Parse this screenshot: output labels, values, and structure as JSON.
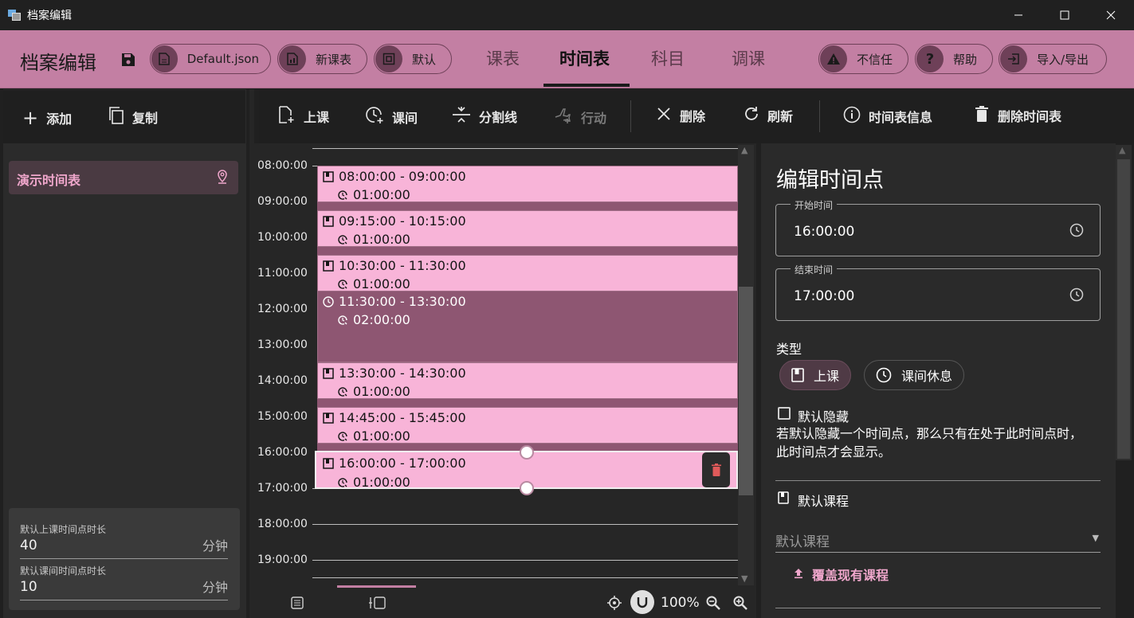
{
  "window": {
    "title": "档案编辑"
  },
  "header": {
    "app_title": "档案编辑",
    "pills": {
      "file": "Default.json",
      "new_schedule": "新课表",
      "default": "默认",
      "distrust": "不信任",
      "help": "帮助",
      "import_export": "导入/导出"
    },
    "tabs": {
      "schedule": "课表",
      "timetable": "时间表",
      "subjects": "科目",
      "swap": "调课"
    },
    "active_tab": "时间表"
  },
  "left": {
    "toolbar": {
      "add": "添加",
      "copy": "复制"
    },
    "items": [
      {
        "label": "演示时间表"
      }
    ],
    "defaults": {
      "lesson_label": "默认上课时间点时长",
      "lesson_value": "40",
      "lesson_unit": "分钟",
      "break_label": "默认课间时间点时长",
      "break_value": "10",
      "break_unit": "分钟"
    }
  },
  "toolbar": {
    "lesson": "上课",
    "break": "课间",
    "divider": "分割线",
    "action": "行动",
    "delete": "删除",
    "refresh": "刷新",
    "info": "时间表信息",
    "delete_table": "删除时间表"
  },
  "timeline": {
    "hours": [
      "08:00:00",
      "09:00:00",
      "10:00:00",
      "11:00:00",
      "12:00:00",
      "13:00:00",
      "14:00:00",
      "15:00:00",
      "16:00:00",
      "17:00:00",
      "18:00:00",
      "19:00:00"
    ],
    "slots": [
      {
        "kind": "lesson",
        "range": "08:00:00 - 09:00:00",
        "duration": "01:00:00"
      },
      {
        "kind": "lesson",
        "range": "09:15:00 - 10:15:00",
        "duration": "01:00:00"
      },
      {
        "kind": "lesson",
        "range": "10:30:00 - 11:30:00",
        "duration": "01:00:00"
      },
      {
        "kind": "break",
        "range": "11:30:00 - 13:30:00",
        "duration": "02:00:00"
      },
      {
        "kind": "lesson",
        "range": "13:30:00 - 14:30:00",
        "duration": "01:00:00"
      },
      {
        "kind": "lesson",
        "range": "14:45:00 - 15:45:00",
        "duration": "01:00:00"
      },
      {
        "kind": "lesson",
        "range": "16:00:00 - 17:00:00",
        "duration": "01:00:00"
      }
    ],
    "zoom": "100%"
  },
  "editor": {
    "title": "编辑时间点",
    "start_label": "开始时间",
    "start_value": "16:00:00",
    "end_label": "结束时间",
    "end_value": "17:00:00",
    "type_label": "类型",
    "type_lesson": "上课",
    "type_break": "课间休息",
    "hide_label": "默认隐藏",
    "hide_desc": "若默认隐藏一个时间点，那么只有在处于此时间点时，此时间点才会显示。",
    "default_course_section": "默认课程",
    "default_course_placeholder": "默认课程",
    "override_btn": "覆盖现有课程"
  },
  "colors": {
    "header": "#c37fa3",
    "lesson": "#f8b4d8",
    "break": "#8e5672",
    "accent": "#f0a7cc"
  }
}
